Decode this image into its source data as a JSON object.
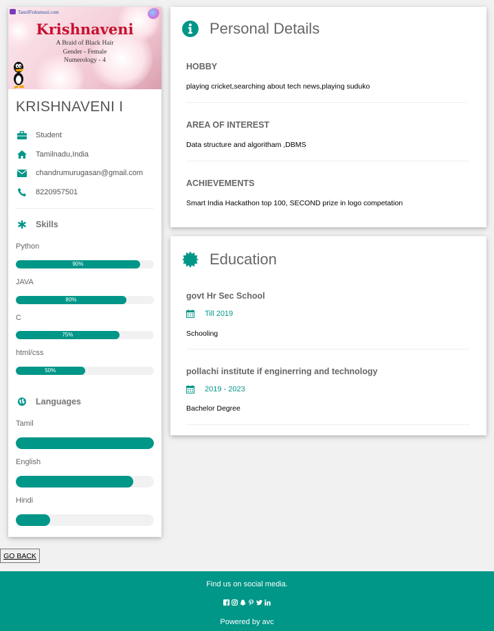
{
  "profile": {
    "banner_site": "TamilFishumuzi.com",
    "banner_title": "Krishnaveni",
    "banner_lines": [
      "A Braid of Black Hair",
      "Gender - Female",
      "Numerology - 4"
    ],
    "name": "KRISHNAVENI I",
    "role": "Student",
    "location": "Tamilnadu,India",
    "email": "chandrumurugasan@gmail.com",
    "phone": "8220957501"
  },
  "skills": {
    "title": "Skills",
    "items": [
      {
        "label": "Python",
        "percent": 90,
        "text": "90%"
      },
      {
        "label": "JAVA",
        "percent": 80,
        "text": "80%"
      },
      {
        "label": "C",
        "percent": 75,
        "text": "75%"
      },
      {
        "label": "html/css",
        "percent": 50,
        "text": "50%"
      }
    ]
  },
  "languages": {
    "title": "Languages",
    "items": [
      {
        "label": "Tamil",
        "percent": 100
      },
      {
        "label": "English",
        "percent": 85
      },
      {
        "label": "Hindi",
        "percent": 25
      }
    ]
  },
  "personal": {
    "title": "Personal Details",
    "items": [
      {
        "heading": "HOBBY",
        "text": "playing cricket,searching about tech news,playing suduko"
      },
      {
        "heading": "AREA OF INTEREST",
        "text": "Data structure and algoritham ,DBMS"
      },
      {
        "heading": "ACHIEVEMENTS",
        "text": "Smart India Hackathon top 100, SECOND prize in logo competation"
      }
    ]
  },
  "education": {
    "title": "Education",
    "items": [
      {
        "school": "govt Hr Sec School",
        "period": "Till 2019",
        "degree": "Schooling"
      },
      {
        "school": "pollachi institute if enginerring and technology",
        "period": "2019 - 2023",
        "degree": "Bachelor Degree"
      }
    ]
  },
  "go_back": "GO BACK",
  "footer": {
    "social_text": "Find us on social media.",
    "powered": "Powered by avc",
    "icons": [
      "facebook-icon",
      "instagram-icon",
      "snapchat-icon",
      "pinterest-icon",
      "twitter-icon",
      "linkedin-icon"
    ]
  },
  "colors": {
    "accent": "#009688",
    "background": "#f1f1f1",
    "banner_title": "#c8102e"
  }
}
